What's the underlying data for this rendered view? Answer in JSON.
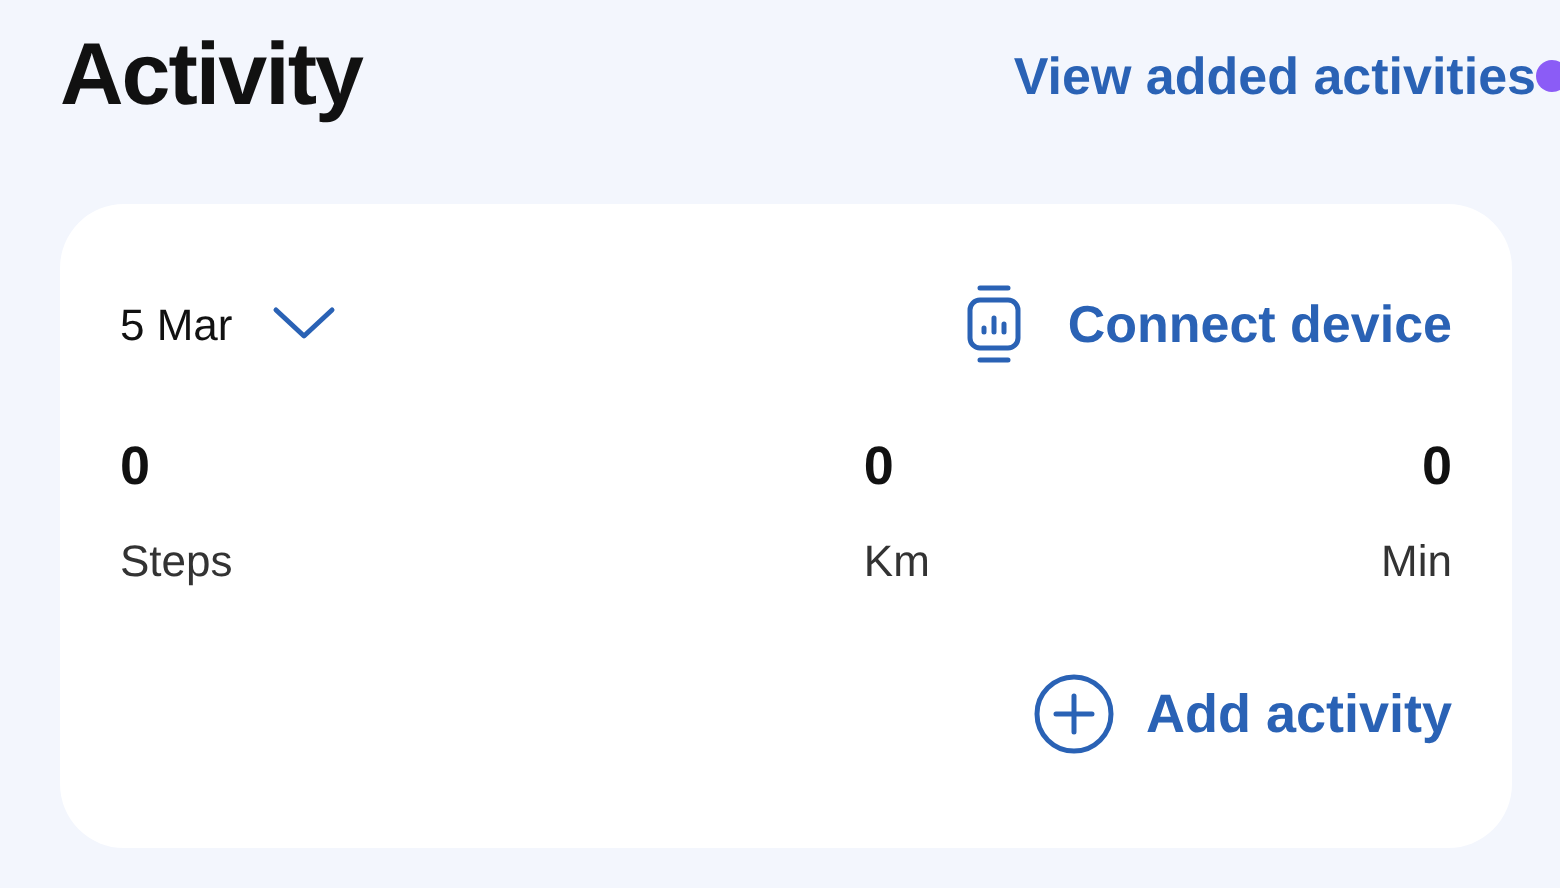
{
  "header": {
    "title": "Activity",
    "link": {
      "label": "View added activities",
      "has_new": true
    }
  },
  "card": {
    "date": "5 Mar",
    "expanded": false,
    "connect": "Connect device",
    "stats": [
      {
        "value": "0",
        "label": "Steps"
      },
      {
        "value": "0",
        "label": "Km"
      },
      {
        "value": "0",
        "label": "Min"
      }
    ],
    "add": "Add activity"
  }
}
